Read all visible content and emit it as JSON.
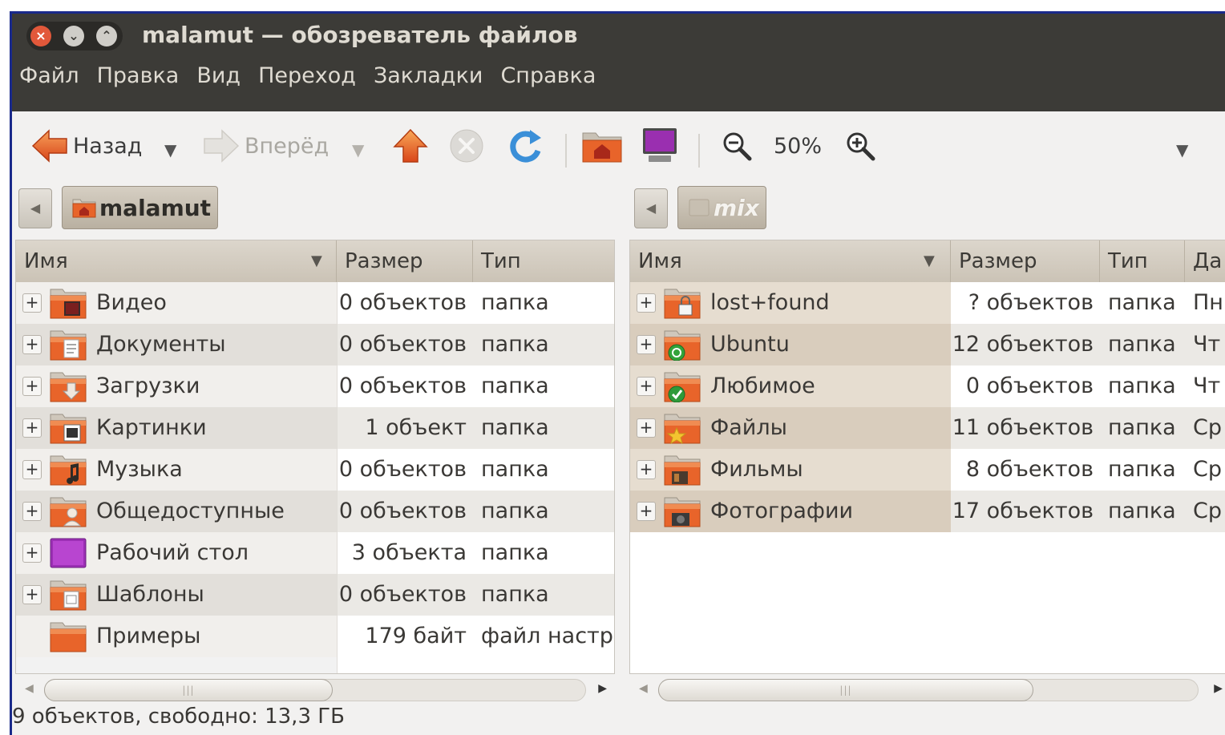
{
  "window": {
    "title": "malamut — обозреватель файлов",
    "controls": {
      "close": "×",
      "minimize": "⌄",
      "maximize": "⌃"
    }
  },
  "menu": [
    "Файл",
    "Правка",
    "Вид",
    "Переход",
    "Закладки",
    "Справка"
  ],
  "toolbar": {
    "back_label": "Назад",
    "forward_label": "Вперёд",
    "zoom_level": "50%"
  },
  "left_pane": {
    "location": "malamut",
    "columns": {
      "name": "Имя",
      "size": "Размер",
      "type": "Тип"
    },
    "rows": [
      {
        "name": "Видео",
        "size": "0 объектов",
        "type": "папка",
        "icon": "video-folder-icon",
        "expandable": true
      },
      {
        "name": "Документы",
        "size": "0 объектов",
        "type": "папка",
        "icon": "documents-folder-icon",
        "expandable": true
      },
      {
        "name": "Загрузки",
        "size": "0 объектов",
        "type": "папка",
        "icon": "downloads-folder-icon",
        "expandable": true
      },
      {
        "name": "Картинки",
        "size": "1 объект",
        "type": "папка",
        "icon": "pictures-folder-icon",
        "expandable": true
      },
      {
        "name": "Музыка",
        "size": "0 объектов",
        "type": "папка",
        "icon": "music-folder-icon",
        "expandable": true
      },
      {
        "name": "Общедоступные",
        "size": "0 объектов",
        "type": "папка",
        "icon": "public-folder-icon",
        "expandable": true
      },
      {
        "name": "Рабочий стол",
        "size": "3 объекта",
        "type": "папка",
        "icon": "desktop-folder-icon",
        "expandable": true
      },
      {
        "name": "Шаблоны",
        "size": "0 объектов",
        "type": "папка",
        "icon": "templates-folder-icon",
        "expandable": true
      },
      {
        "name": "Примеры",
        "size": "179 байт",
        "type": "файл настр",
        "icon": "folder-icon",
        "expandable": false
      }
    ]
  },
  "right_pane": {
    "location": "mix",
    "columns": {
      "name": "Имя",
      "size": "Размер",
      "type": "Тип",
      "date": "Да"
    },
    "rows": [
      {
        "name": "lost+found",
        "size": "? объектов",
        "type": "папка",
        "date": "Пн",
        "icon": "locked-folder-icon"
      },
      {
        "name": "Ubuntu",
        "size": "12 объектов",
        "type": "папка",
        "date": "Чт",
        "icon": "ubuntu-folder-icon"
      },
      {
        "name": "Любимое",
        "size": "0 объектов",
        "type": "папка",
        "date": "Чт",
        "icon": "favorite-folder-icon"
      },
      {
        "name": "Файлы",
        "size": "11 объектов",
        "type": "папка",
        "date": "Ср",
        "icon": "star-folder-icon"
      },
      {
        "name": "Фильмы",
        "size": "8 объектов",
        "type": "папка",
        "date": "Ср",
        "icon": "movies-folder-icon"
      },
      {
        "name": "Фотографии",
        "size": "17 объектов",
        "type": "папка",
        "date": "Ср",
        "icon": "photos-folder-icon"
      }
    ]
  },
  "status": "9 объектов, свободно: 13,3 ГБ",
  "colors": {
    "titlebar": "#3c3b37",
    "title_text": "#dfdbd2",
    "close_button": "#e2583a",
    "folder_orange": "#e8642a",
    "selected_row": "#d4c8b8"
  }
}
